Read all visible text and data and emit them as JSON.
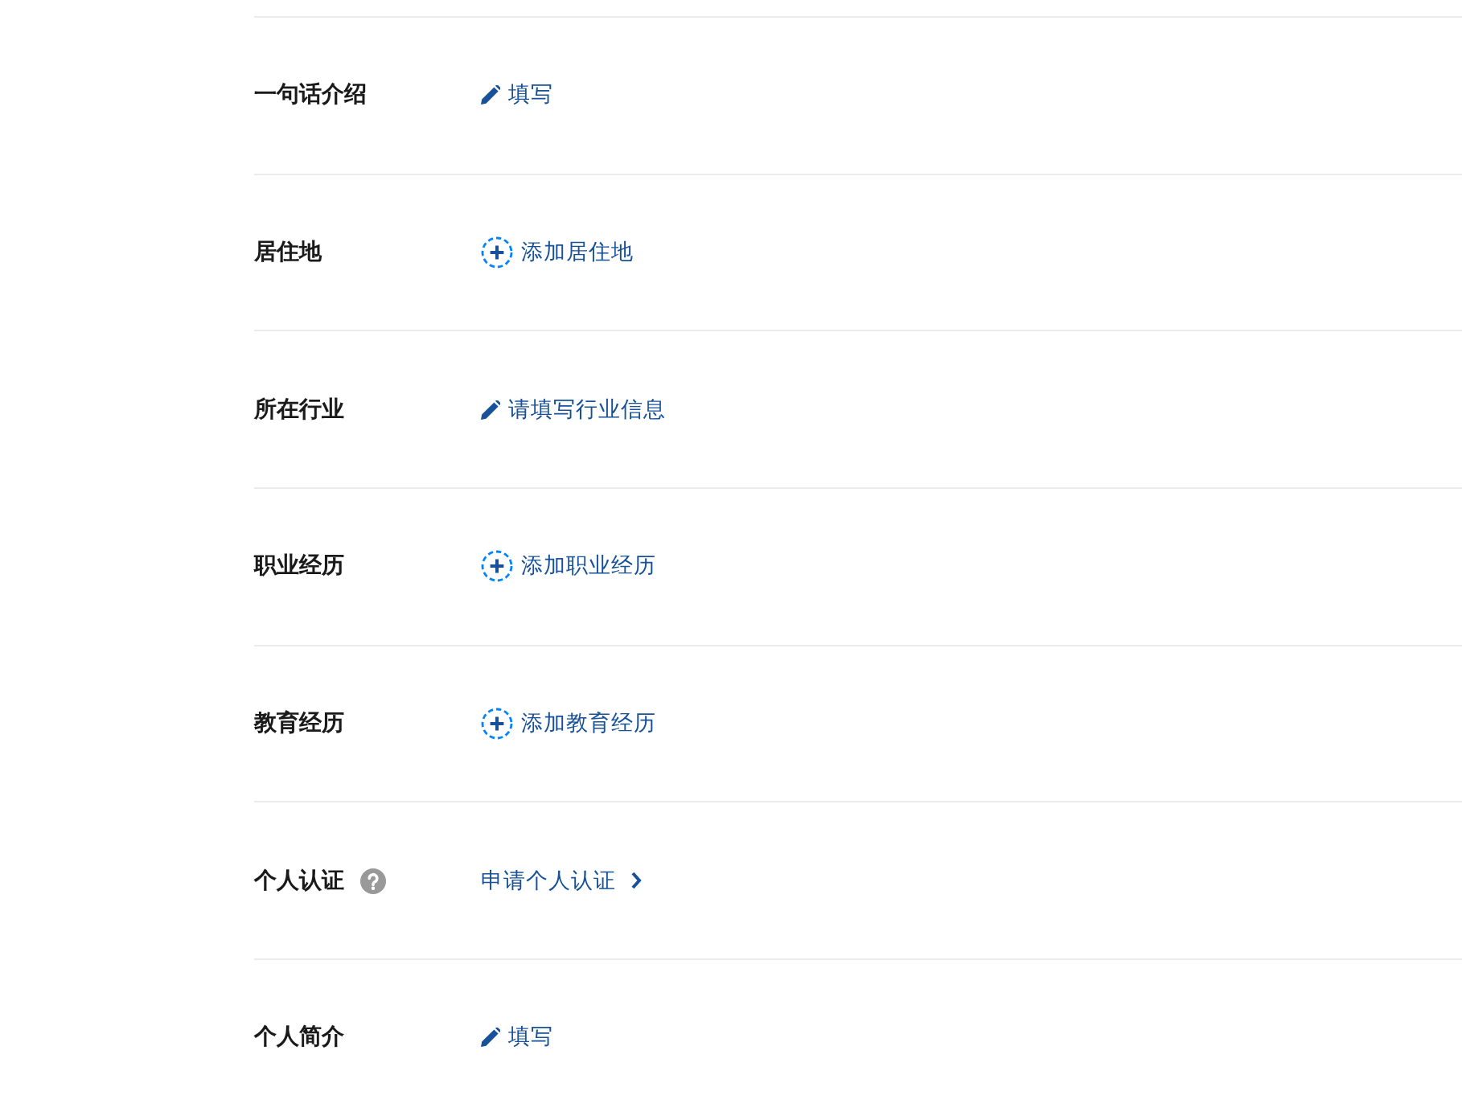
{
  "rows": [
    {
      "label": "一句话介绍",
      "help": false,
      "action": {
        "kind": "edit",
        "text": "填写"
      }
    },
    {
      "label": "居住地",
      "help": false,
      "action": {
        "kind": "add",
        "text": "添加居住地"
      }
    },
    {
      "label": "所在行业",
      "help": false,
      "action": {
        "kind": "edit",
        "text": "请填写行业信息"
      }
    },
    {
      "label": "职业经历",
      "help": false,
      "action": {
        "kind": "add",
        "text": "添加职业经历"
      }
    },
    {
      "label": "教育经历",
      "help": false,
      "action": {
        "kind": "add",
        "text": "添加教育经历"
      }
    },
    {
      "label": "个人认证",
      "help": true,
      "action": {
        "kind": "link",
        "text": "申请个人认证"
      }
    },
    {
      "label": "个人简介",
      "help": false,
      "action": {
        "kind": "edit",
        "text": "填写"
      }
    }
  ]
}
